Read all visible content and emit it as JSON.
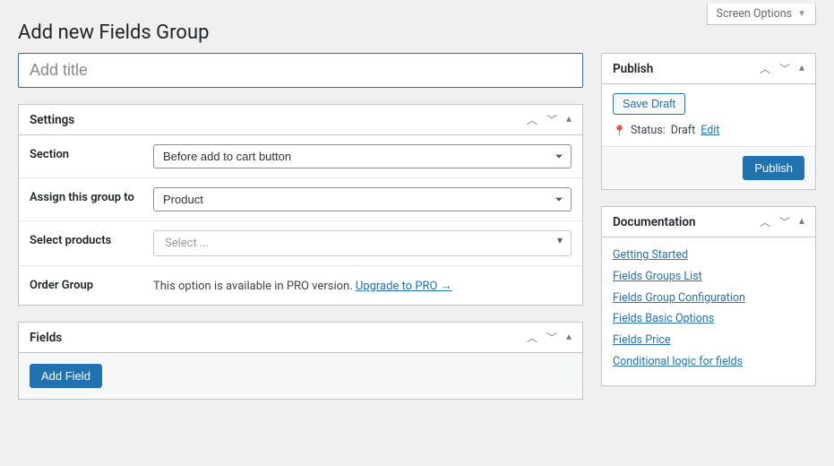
{
  "screen_options_label": "Screen Options",
  "page_title": "Add new Fields Group",
  "title_placeholder": "Add title",
  "settings": {
    "heading": "Settings",
    "rows": {
      "section": {
        "label": "Section",
        "value": "Before add to cart button"
      },
      "assign": {
        "label": "Assign this group to",
        "value": "Product"
      },
      "select_products": {
        "label": "Select products",
        "placeholder": "Select ..."
      },
      "order_group": {
        "label": "Order Group",
        "text": "This option is available in PRO version. ",
        "link": "Upgrade to PRO →"
      }
    }
  },
  "fields": {
    "heading": "Fields",
    "add_button": "Add Field"
  },
  "publish": {
    "heading": "Publish",
    "save_draft": "Save Draft",
    "status_label": "Status:",
    "status_value": "Draft",
    "edit_link": "Edit",
    "publish_button": "Publish"
  },
  "documentation": {
    "heading": "Documentation",
    "links": [
      "Getting Started",
      "Fields Groups List",
      "Fields Group Configuration",
      "Fields Basic Options",
      "Fields Price",
      "Conditional logic for fields"
    ]
  }
}
